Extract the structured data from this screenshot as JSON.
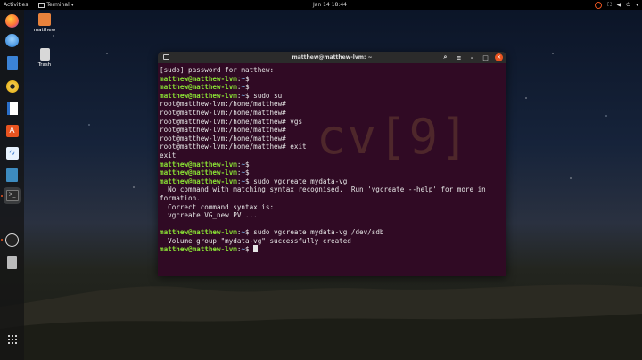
{
  "topbar": {
    "activities": "Activities",
    "app_name": "Terminal",
    "clock": "Jan 14  18:44"
  },
  "desktop": {
    "icons": [
      {
        "label": "matthew",
        "icon": "folder-icon"
      },
      {
        "label": "Trash",
        "icon": "trash-icon"
      }
    ]
  },
  "dock": {
    "items": [
      "firefox",
      "thunderbird",
      "files",
      "rhythmbox",
      "writer",
      "software",
      "system-monitor",
      "code",
      "terminal",
      "obs",
      "notes"
    ]
  },
  "terminal": {
    "title": "matthew@matthew-lvm: ~",
    "watermark": "cv[9]",
    "prompt_user": "matthew@matthew-lvm",
    "lines": [
      {
        "type": "out",
        "text": "[sudo] password for matthew:"
      },
      {
        "type": "prompt",
        "path": "~",
        "cmd": ""
      },
      {
        "type": "prompt",
        "path": "~",
        "cmd": ""
      },
      {
        "type": "prompt",
        "path": "~",
        "cmd": "sudo su"
      },
      {
        "type": "out",
        "text": "root@matthew-lvm:/home/matthew#"
      },
      {
        "type": "out",
        "text": "root@matthew-lvm:/home/matthew#"
      },
      {
        "type": "out",
        "text": "root@matthew-lvm:/home/matthew# vgs"
      },
      {
        "type": "out",
        "text": "root@matthew-lvm:/home/matthew#"
      },
      {
        "type": "out",
        "text": "root@matthew-lvm:/home/matthew#"
      },
      {
        "type": "out",
        "text": "root@matthew-lvm:/home/matthew# exit"
      },
      {
        "type": "out",
        "text": "exit"
      },
      {
        "type": "prompt",
        "path": "~",
        "cmd": ""
      },
      {
        "type": "prompt",
        "path": "~",
        "cmd": ""
      },
      {
        "type": "prompt",
        "path": "~",
        "cmd": "sudo vgcreate mydata-vg"
      },
      {
        "type": "out",
        "text": "  No command with matching syntax recognised.  Run 'vgcreate --help' for more in"
      },
      {
        "type": "out",
        "text": "formation."
      },
      {
        "type": "out",
        "text": "  Correct command syntax is:"
      },
      {
        "type": "out",
        "text": "  vgcreate VG_new PV ..."
      },
      {
        "type": "out",
        "text": ""
      },
      {
        "type": "prompt",
        "path": "~",
        "cmd": "sudo vgcreate mydata-vg /dev/sdb"
      },
      {
        "type": "out",
        "text": "  Volume group \"mydata-vg\" successfully created"
      },
      {
        "type": "prompt",
        "path": "~",
        "cmd": "",
        "cursor": true
      }
    ]
  }
}
